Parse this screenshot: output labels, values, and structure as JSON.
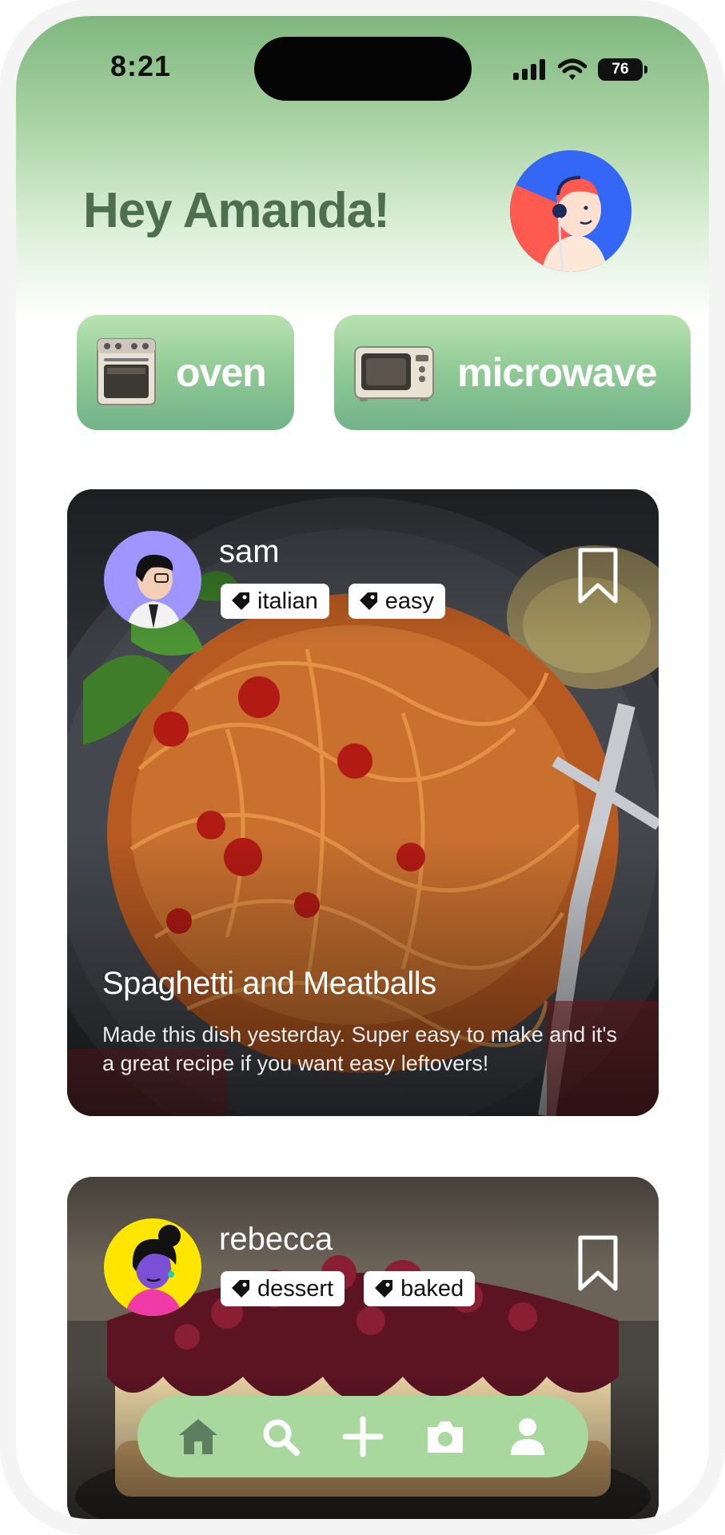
{
  "status_bar": {
    "time": "8:21",
    "battery": "76",
    "icons": [
      "signal-icon",
      "wifi-icon",
      "battery-icon"
    ]
  },
  "header": {
    "greeting": "Hey Amanda!",
    "profile_avatar": "profile-avatar"
  },
  "appliances": [
    {
      "label": "oven",
      "icon": "oven-icon"
    },
    {
      "label": "microwave",
      "icon": "microwave-icon"
    }
  ],
  "posts": [
    {
      "author": "sam",
      "tags": [
        "italian",
        "easy"
      ],
      "title": "Spaghetti and Meatballs",
      "description": "Made this dish yesterday. Super easy to make and it's a great recipe if you want easy leftovers!",
      "bookmark_icon": "bookmark-icon"
    },
    {
      "author": "rebecca",
      "tags": [
        "dessert",
        "baked"
      ],
      "bookmark_icon": "bookmark-icon"
    }
  ],
  "bottom_nav": {
    "items": [
      "home-icon",
      "search-icon",
      "add-icon",
      "camera-icon",
      "profile-icon"
    ],
    "active": "home-icon"
  },
  "colors": {
    "header_green": "#7fb77e",
    "greeting_text": "#4d6f4d",
    "chip_green": "#8fc995",
    "nav_green": "#a8d89e",
    "nav_active": "#5d7f60"
  }
}
